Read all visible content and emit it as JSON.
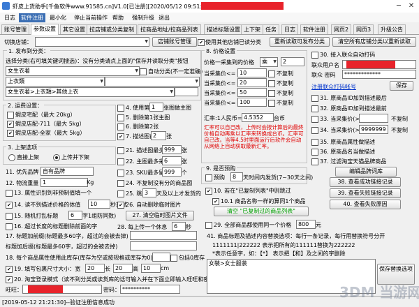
{
  "window": {
    "title": "虾皮上货助手[千鱼软件www.91585.cn]V1.0[已注册][2020/05/12 09:51:41到期]-",
    "minimize": "─",
    "close": "✕"
  },
  "menu": [
    "日志",
    "软件注册",
    "最小化",
    "停止当前操作",
    "帮助",
    "强制升级",
    "退出"
  ],
  "tabs": [
    "账号管理",
    "参数设置",
    "其它设置",
    "拉店铺或分类复制",
    "拉商品地址/拉商品列表",
    "描述标题设置",
    "上下架",
    "任务",
    "日志",
    "软件注册",
    "网页2",
    "网页3",
    "升级公告"
  ],
  "store": {
    "label": "切换店铺：",
    "value": "",
    "manage_button": "店铺账号管理",
    "use_other_store_label": "使用其他店铺已读分类",
    "re_read_button": "重新读取可发布分类",
    "clear_button": "清空所有店铺分类以重新读取"
  },
  "section1": {
    "title": "1. 发布到分类：",
    "hint": "选择分类(右可填关键词搜选)：没有分类请点上面的\"保存并读取分类\"按钮",
    "cat1": "女生衣著",
    "auto_cat_label": "自动分类(不一定准确)",
    "cat2": "上衣類",
    "cat3": "",
    "path": "女生衣著>上衣類>其他上衣"
  },
  "section2": {
    "title": "2. 运费设置：",
    "items": [
      "蝦皮宅配（最大 20kg）",
      "蝦皮店配-711（最大 5kg）",
      "蝦皮店配-全家（最大 5kg）"
    ]
  },
  "section3": {
    "title": "3. 上架选项",
    "opt1": "直接上架",
    "opt2": "上传并下架"
  },
  "brand": {
    "label": "11. 优先品牌",
    "value": "自有品牌"
  },
  "weight": {
    "label": "12. 物流重量",
    "value": "1",
    "unit": "Kg"
  },
  "attr_label": "13. 属性识别到非预制值填一个",
  "opts_left": [
    {
      "label": "14. 读不到描述价格的体值",
      "value": "10",
      "unit": "秒重试"
    },
    {
      "label": "15. 随机打乱标题",
      "value": "6",
      "unit": "字1组防同数)"
    },
    {
      "label": "16. 超过长度的标题删除前面的字"
    }
  ],
  "title_prefix_label": "17. 标题加前缀(标题最多60字，超过的会被去掉)",
  "title_suffix_label": "标题加后缀(标题最多60字，超过的会被去掉)",
  "section18": {
    "label": "18. 每个商品属性使用此库存(库存为空或按规格或库存为0)",
    "bracket_label": "包括0库存"
  },
  "section19": {
    "label": "19. 填写包裹尺寸大小：宽",
    "w": "20",
    "l_label": "长",
    "l": "20",
    "h_label": "高",
    "h": "10",
    "unit": "cm"
  },
  "section20": {
    "label": "20. 淘宝登录模式（读不到分类或读货库的话可输入并在下面立即输入旺旺和密码）"
  },
  "wangwang": {
    "label": "旺旺：",
    "value": "",
    "pwd_label": "密码：",
    "pwd": "**********"
  },
  "mid": {
    "use_label": "4. 使用第",
    "use_value": "1",
    "use_unit": "张图做主图",
    "del_first": "5. 删除第1张主图",
    "del_second": "6. 删除第2张",
    "desc_pic_label": "7. 描述图前",
    "desc_pic_value": "2",
    "desc_pic_unit": "张",
    "desc_max_label": "21. 描述图最多采",
    "desc_max_value": "999",
    "desc_max_unit": "张",
    "main_max_label": "22. 主图最多采集",
    "main_max_value": "6",
    "main_max_unit": "张",
    "sku_max_label": "23. SKU最多留",
    "sku_max_value": "999",
    "sku_max_unit": "个",
    "cat_no_pic": "24. 不复制没有分的商品图",
    "skip_label": "25. 跳过",
    "skip_value": "3",
    "skip_unit": "天及以上才发货的",
    "auto_del": "26. 自动删除临时图片",
    "clear_temp_btn": "27. 清空临时图片文件",
    "rest_label": "28. 每上传一个休息",
    "rest_value": "6",
    "rest_unit": "秒"
  },
  "price": {
    "title": "8. 价格设置",
    "range_label": "价格一采集到的价格",
    "op": "乘",
    "op_value": "2",
    "rows": [
      {
        "label": "当采集价<=",
        "value": "10",
        "tail": "不复制"
      },
      {
        "label": "当采集价<=",
        "value": "20",
        "tail": "不复制"
      },
      {
        "label": "当采集价<=",
        "value": "50",
        "tail": "不复制"
      },
      {
        "label": "当采集价<=",
        "value": "100",
        "tail": "不复制"
      }
    ],
    "rate_label": "汇率:1人民币=",
    "rate_value": "4.5352",
    "rate_unit": "台币",
    "note": "汇率可以自己改，上传时会按计算后的最终价格自动再乘以汇率来转换成台币。汇率可自己改。当等4.5时里面运行后软件会自动从网络上自动获取最新汇率。"
  },
  "presale": {
    "title": "9. 是否预购",
    "opt": "预购",
    "value": "8",
    "unit": "天时间内发货(7~30天之间)"
  },
  "opt10": {
    "label": "10. 若在\"已复制列表\"中则跳过"
  },
  "opt101": {
    "label": "10.1 商品名称一样的算同1个商品"
  },
  "clear_copied_btn": "清空 \"已复制过的商品列表\"",
  "opt29": {
    "label": "29. 全部商品都使用同一个价格",
    "value": "800",
    "unit": "元"
  },
  "rules": {
    "title": "41. 商品标题及描述内容替换选项：每行一条记录，每行用替换符号分开",
    "example": "1111111|222222     表示把所有的111111替换为222222",
    "hint": "*表示任意字，如：【*】   表示把【和】及之间的字删除",
    "content": "女裝>女士服装",
    "save_btn": "保存替换选项"
  },
  "right": {
    "auto_login": "30. 接入联众自动打码",
    "user_label": "联众用户名",
    "user_value": "",
    "pwd_label": "联众 密码",
    "pwd_value": "*************",
    "reg_link": "注册联众打码帐号",
    "save_btn": "保存",
    "items": [
      {
        "label": "31. 原商品ID加到描述最后"
      },
      {
        "label": "32. 原商品ID加到描述最前"
      },
      {
        "label": "33. 当采集价(>=",
        "value": "",
        "tail": "不复制"
      },
      {
        "label": "34. 当采集价(>=",
        "value": "9999999",
        "tail": "不复制"
      },
      {
        "label": "35. 原商品属性做描述"
      },
      {
        "label": "36. 原商品名当做描述"
      },
      {
        "label": "37. 过滤淘宝天猫品牌商品"
      }
    ],
    "edit_brand_btn": "编辑品牌词库",
    "btn38": "38. 查看成功链接记录",
    "btn39": "39. 查看失败链接记录",
    "btn40": "40. 查看失败原因"
  },
  "status": "[2019-05-12 21:21:30]--验证注册信息成功",
  "watermark": "3DM 当游网",
  "colors": {
    "accent": "#3c6fb4",
    "note_red": "#e00000",
    "link_blue": "#0033cc",
    "title_red": "#e8232b"
  }
}
